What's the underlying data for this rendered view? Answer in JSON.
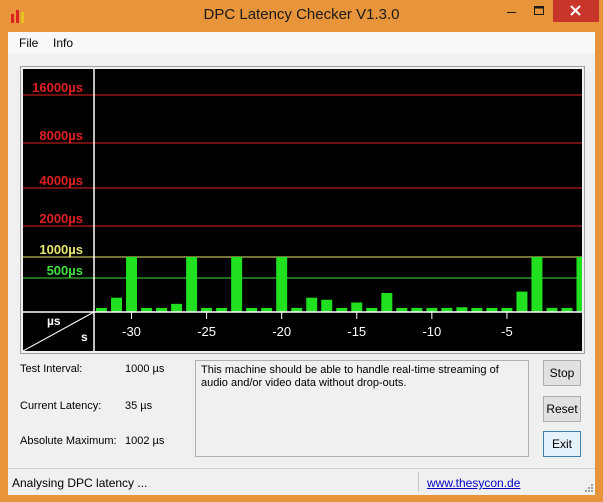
{
  "window": {
    "title": "DPC Latency Checker V1.3.0",
    "colors": {
      "frame": "#e8943b",
      "close": "#c7352b"
    },
    "icons": {
      "app": "bar-chart-icon",
      "minimize": "minimize-icon",
      "maximize": "maximize-icon",
      "close": "close-icon"
    }
  },
  "menu": {
    "file": "File",
    "info": "Info"
  },
  "chart_data": {
    "type": "bar",
    "y_axis_labels": [
      {
        "label": "16000µs",
        "value": 16000,
        "color": "#e02020"
      },
      {
        "label": "8000µs",
        "value": 8000,
        "color": "#e02020"
      },
      {
        "label": "4000µs",
        "value": 4000,
        "color": "#e02020"
      },
      {
        "label": "2000µs",
        "value": 2000,
        "color": "#e02020"
      },
      {
        "label": "1000µs",
        "value": 1000,
        "color": "#e8e870"
      },
      {
        "label": "500µs",
        "value": 500,
        "color": "#40e040"
      }
    ],
    "x_tick_labels": [
      "-30",
      "-25",
      "-20",
      "-15",
      "-10",
      "-5"
    ],
    "x_ticks": [
      -30,
      -25,
      -20,
      -15,
      -10,
      -5
    ],
    "xlim": [
      -32.5,
      0
    ],
    "corner_labels": {
      "top": "µs",
      "bottom": "s"
    },
    "x": [
      -32,
      -31,
      -30,
      -29,
      -28,
      -27,
      -26,
      -25,
      -24,
      -23,
      -22,
      -21,
      -20,
      -19,
      -18,
      -17,
      -16,
      -15,
      -14,
      -13,
      -12,
      -11,
      -10,
      -9,
      -8,
      -7,
      -6,
      -5,
      -4,
      -3,
      -2,
      -1,
      0
    ],
    "values": [
      60,
      210,
      1000,
      60,
      60,
      120,
      1000,
      60,
      60,
      1000,
      60,
      60,
      1000,
      60,
      210,
      180,
      60,
      140,
      60,
      280,
      60,
      60,
      60,
      60,
      70,
      60,
      60,
      60,
      300,
      1000,
      60,
      60,
      1000
    ],
    "bar_color": "#20e020",
    "background": "#000000",
    "grid": true
  },
  "stats": {
    "test_interval_label": "Test Interval:",
    "test_interval_value": "1000 µs",
    "current_latency_label": "Current Latency:",
    "current_latency_value": "35 µs",
    "absolute_maximum_label": "Absolute Maximum:",
    "absolute_maximum_value": "1002 µs"
  },
  "message": "This machine should be able to handle real-time streaming of audio and/or video data without drop-outs.",
  "buttons": {
    "stop": "Stop",
    "reset": "Reset",
    "exit": "Exit"
  },
  "status": {
    "text": "Analysing DPC latency ...",
    "link": "www.thesycon.de"
  }
}
